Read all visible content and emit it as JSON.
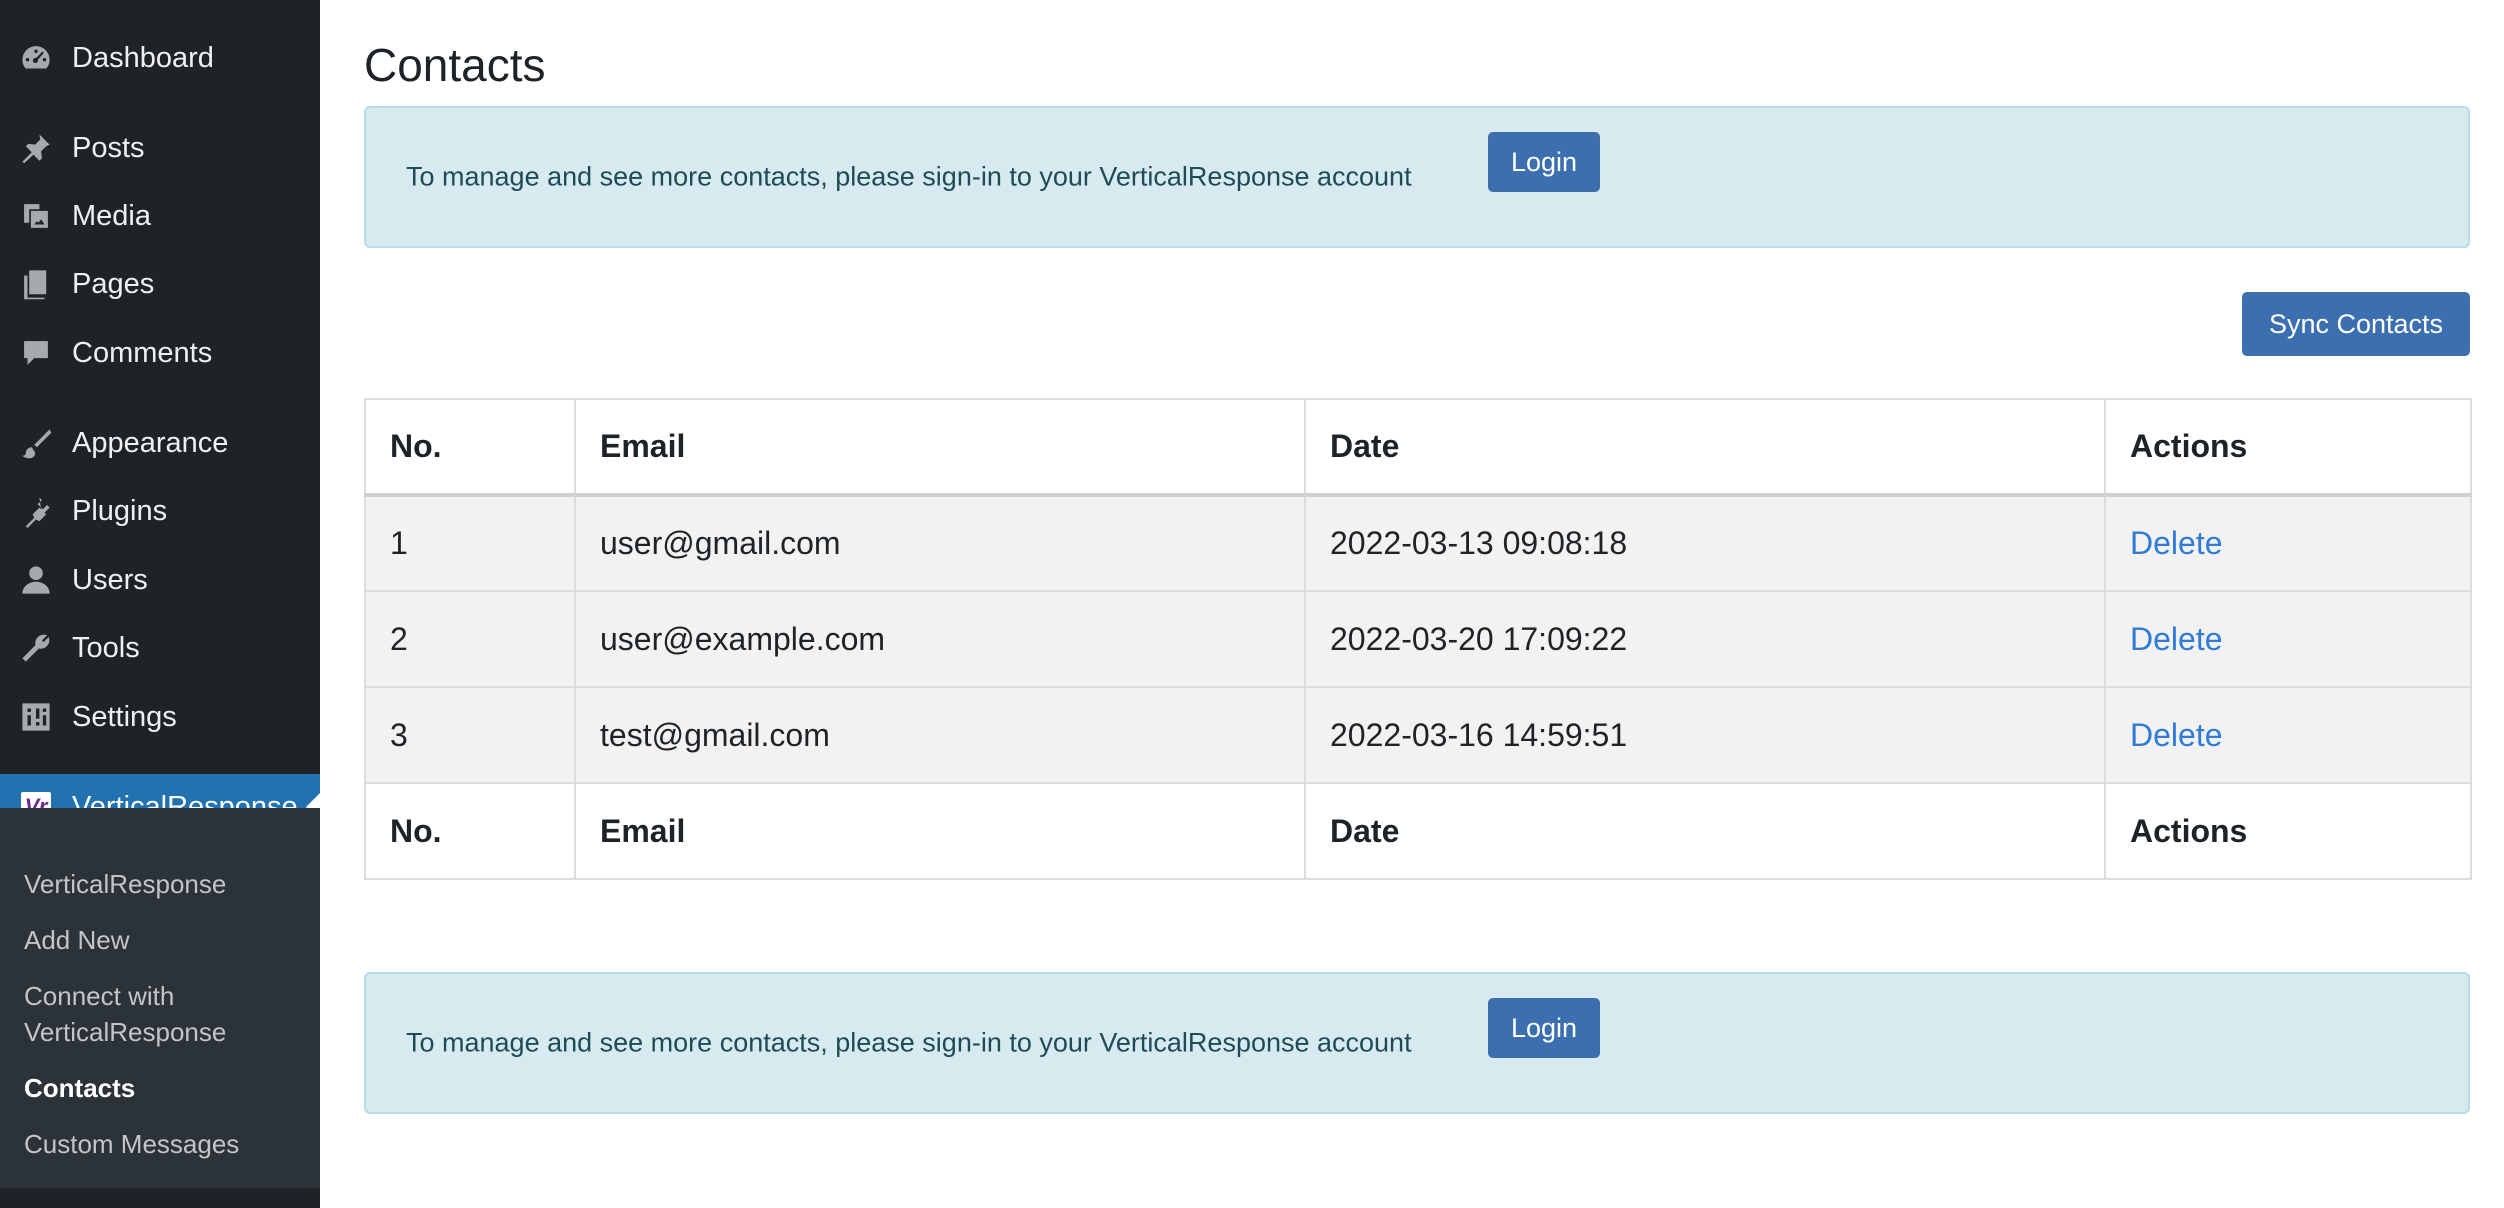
{
  "sidebar": {
    "menu": [
      {
        "id": "dashboard",
        "label": "Dashboard",
        "icon": "dashboard-icon"
      },
      {
        "id": "posts",
        "label": "Posts",
        "icon": "pushpin-icon"
      },
      {
        "id": "media",
        "label": "Media",
        "icon": "media-icon"
      },
      {
        "id": "pages",
        "label": "Pages",
        "icon": "pages-icon"
      },
      {
        "id": "comments",
        "label": "Comments",
        "icon": "comment-icon"
      },
      {
        "id": "appearance",
        "label": "Appearance",
        "icon": "paintbrush-icon"
      },
      {
        "id": "plugins",
        "label": "Plugins",
        "icon": "plugin-icon"
      },
      {
        "id": "users",
        "label": "Users",
        "icon": "user-icon"
      },
      {
        "id": "tools",
        "label": "Tools",
        "icon": "wrench-icon"
      },
      {
        "id": "settings",
        "label": "Settings",
        "icon": "sliders-icon"
      },
      {
        "id": "verticalresponse",
        "label": "VerticalResponse",
        "icon": "verticalresponse-logo-icon",
        "active": true
      }
    ],
    "submenu": [
      {
        "label": "VerticalResponse"
      },
      {
        "label": "Add New"
      },
      {
        "label": "Connect with VerticalResponse"
      },
      {
        "label": "Contacts",
        "current": true
      },
      {
        "label": "Custom Messages"
      }
    ]
  },
  "main": {
    "title": "Contacts",
    "notice": {
      "message": "To manage and see more contacts, please sign-in to your VerticalResponse account",
      "login_label": "Login"
    },
    "sync_label": "Sync Contacts",
    "table": {
      "columns": [
        "No.",
        "Email",
        "Date",
        "Actions"
      ],
      "rows": [
        {
          "no": "1",
          "email": "user@gmail.com",
          "date": "2022-03-13 09:08:18",
          "action": "Delete"
        },
        {
          "no": "2",
          "email": "user@example.com",
          "date": "2022-03-20 17:09:22",
          "action": "Delete"
        },
        {
          "no": "3",
          "email": "test@gmail.com",
          "date": "2022-03-16 14:59:51",
          "action": "Delete"
        }
      ]
    }
  },
  "colors": {
    "sidebar_bg": "#1d2327",
    "submenu_bg": "#2c3338",
    "active_menu_bg": "#2271b1",
    "notice_bg": "#d7eaf0",
    "button_bg": "#3b6faf",
    "link": "#2f7bd6"
  }
}
